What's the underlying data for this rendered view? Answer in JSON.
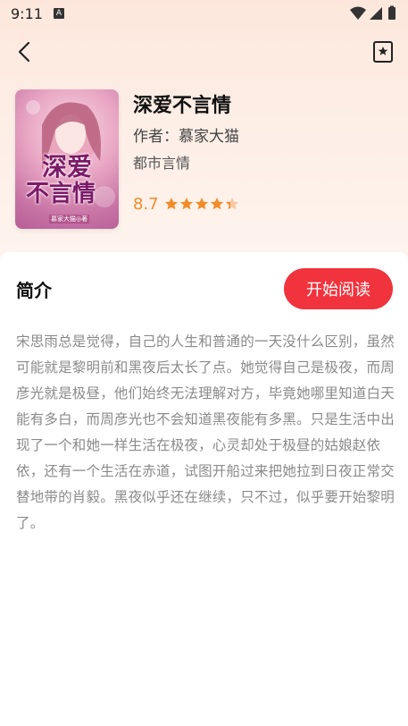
{
  "status_bar": {
    "time": "9:11",
    "notification_icon": "a-icon"
  },
  "book": {
    "title": "深爱不言情",
    "author_label": "作者：慕家大猫",
    "genre": "都市言情",
    "rating": "8.7",
    "rating_fraction": 0.87,
    "cover": {
      "title_line1": "深爱",
      "title_line2": "不言情",
      "author": "慕家大猫◎著"
    }
  },
  "intro": {
    "heading": "简介",
    "read_button": "开始阅读",
    "text": "宋思雨总是觉得，自己的人生和普通的一天没什么区别，虽然可能就是黎明前和黑夜后太长了点。她觉得自己是极夜，而周彦光就是极昼，他们始终无法理解对方，毕竟她哪里知道白天能有多白，而周彦光也不会知道黑夜能有多黑。只是生活中出现了一个和她一样生活在极夜，心灵却处于极昼的姑娘赵依依，还有一个生活在赤道，试图开船过来把她拉到日夜正常交替地带的肖毅。黑夜似乎还在继续，只不过，似乎要开始黎明了。"
  },
  "colors": {
    "accent": "#f0333d",
    "star": "#f28c28",
    "star_empty": "#f6c9a0"
  },
  "icons": {
    "back": "chevron-left-icon",
    "bookmark": "bookmark-star-icon"
  }
}
